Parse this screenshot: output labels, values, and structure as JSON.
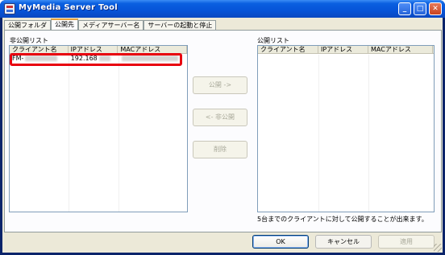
{
  "window": {
    "title": "MyMedia Server Tool",
    "icons": {
      "minimize": "minimize-icon",
      "maximize": "maximize-icon",
      "close": "close-icon",
      "app": "app-icon"
    },
    "minimize_glyph": "_",
    "maximize_glyph": "□",
    "close_glyph": "✕"
  },
  "tabs": [
    {
      "label": "公開フォルダ",
      "active": false
    },
    {
      "label": "公開先",
      "active": true
    },
    {
      "label": "メディアサーバー名",
      "active": false
    },
    {
      "label": "サーバーの起動と停止",
      "active": false
    }
  ],
  "private_list": {
    "label": "非公開リスト",
    "columns": [
      "クライアント名",
      "IPアドレス",
      "MACアドレス"
    ],
    "rows": [
      {
        "client": "FM-",
        "ip": "192.168",
        "mac": ""
      }
    ]
  },
  "public_list": {
    "label": "公開リスト",
    "columns": [
      "クライアント名",
      "IPアドレス",
      "MACアドレス"
    ],
    "rows": []
  },
  "actions": {
    "publish": "公開 ->",
    "unpublish": "<- 非公開",
    "delete": "削除"
  },
  "note": "5台までのクライアントに対して公開することが出来ます。",
  "footer": {
    "ok": "OK",
    "cancel": "キャンセル",
    "apply": "適用"
  },
  "colors": {
    "highlight": "#e8000f",
    "titlebar": "#0654d8",
    "active_tab_accent": "#e6a23c"
  }
}
